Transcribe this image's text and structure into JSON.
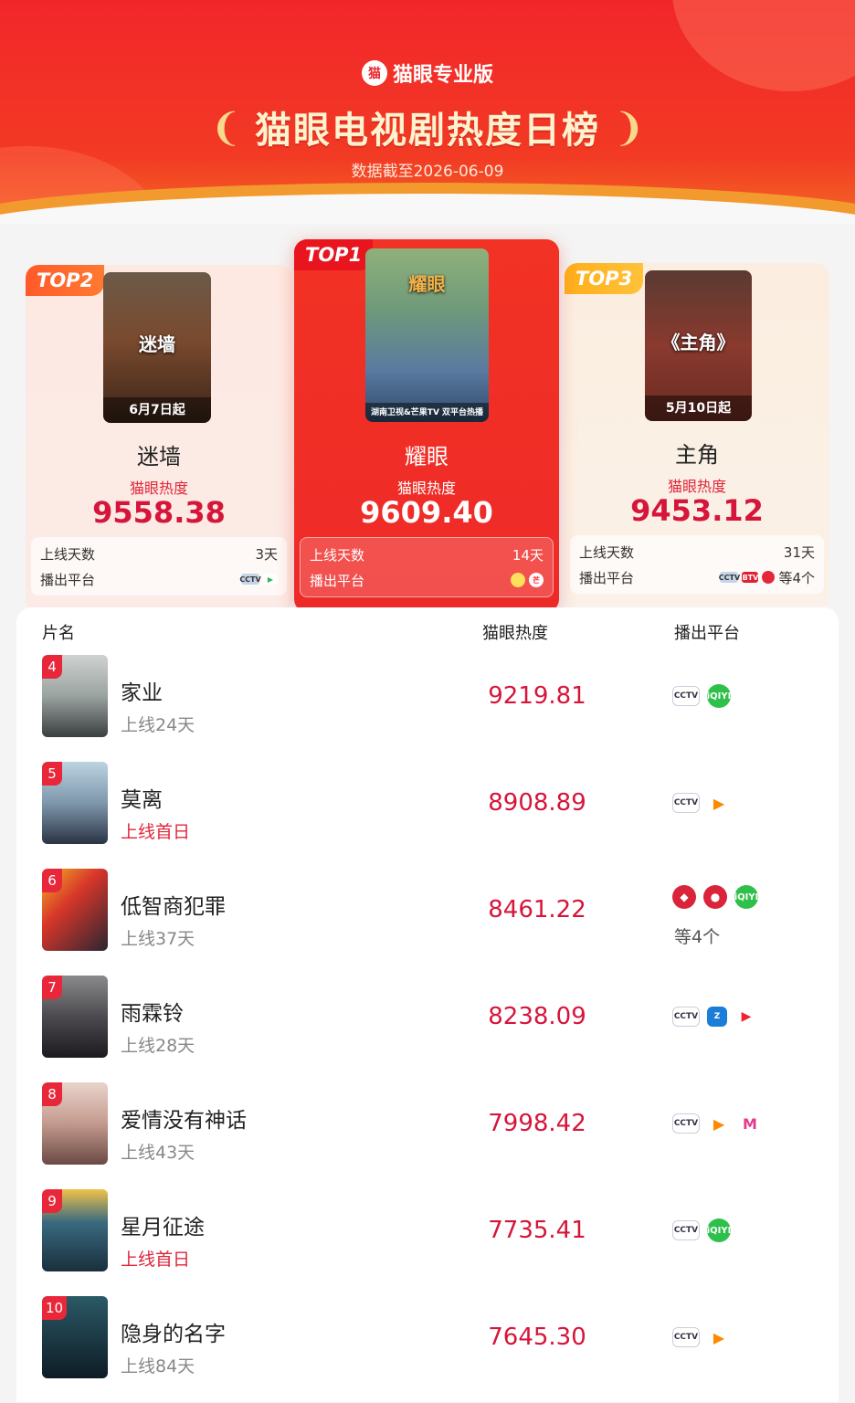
{
  "header": {
    "brand": "猫眼专业版",
    "logo_glyph": "猫",
    "title": "猫眼电视剧热度日榜",
    "date": "数据截至2026-06-09"
  },
  "podium": {
    "heat_label": "猫眼热度",
    "days_label": "上线天数",
    "platform_label": "播出平台",
    "top1": {
      "rank": "TOP1",
      "name": "耀眼",
      "heat": "9609.40",
      "days": "14天",
      "poster_caption": "湖南卫视&芒果TV 双平台热播",
      "poster_title": "耀眼",
      "platforms": [
        "hunan-tv-icon",
        "mango-tv-icon"
      ]
    },
    "top2": {
      "rank": "TOP2",
      "name": "迷墙",
      "heat": "9558.38",
      "days": "3天",
      "poster_caption": "6月7日起",
      "poster_title": "迷墙",
      "platforms": [
        "cctv-icon",
        "tencent-video-icon"
      ]
    },
    "top3": {
      "rank": "TOP3",
      "name": "主角",
      "heat": "9453.12",
      "days": "31天",
      "poster_caption": "5月10日起",
      "poster_title": "《主角》",
      "platforms": [
        "cctv-icon",
        "btv-icon",
        "red-icon"
      ],
      "platforms_more": "等4个"
    }
  },
  "list": {
    "headers": {
      "name": "片名",
      "heat": "猫眼热度",
      "platform": "播出平台"
    },
    "rows": [
      {
        "rank": "4",
        "name": "家业",
        "sub": "上线24天",
        "heat": "9219.81",
        "first": false,
        "platforms": [
          "cctv",
          "iqiyi"
        ]
      },
      {
        "rank": "5",
        "name": "莫离",
        "sub": "上线首日",
        "heat": "8908.89",
        "first": true,
        "platforms": [
          "cctv",
          "tencent"
        ]
      },
      {
        "rank": "6",
        "name": "低智商犯罪",
        "sub": "上线37天",
        "heat": "8461.22",
        "first": false,
        "platforms": [
          "red",
          "red2",
          "iqiyi"
        ],
        "more": "等4个"
      },
      {
        "rank": "7",
        "name": "雨霖铃",
        "sub": "上线28天",
        "heat": "8238.09",
        "first": false,
        "platforms": [
          "cctv",
          "zj",
          "youku"
        ]
      },
      {
        "rank": "8",
        "name": "爱情没有神话",
        "sub": "上线43天",
        "heat": "7998.42",
        "first": false,
        "platforms": [
          "cctv",
          "tencent",
          "mango"
        ]
      },
      {
        "rank": "9",
        "name": "星月征途",
        "sub": "上线首日",
        "heat": "7735.41",
        "first": true,
        "platforms": [
          "cctv",
          "iqiyi"
        ]
      },
      {
        "rank": "10",
        "name": "隐身的名字",
        "sub": "上线84天",
        "heat": "7645.30",
        "first": false,
        "platforms": [
          "cctv",
          "tencent"
        ]
      }
    ]
  },
  "colors": {
    "brand_red": "#e8262a",
    "heat_red": "#d6153a",
    "gold": "#f8d98c"
  }
}
